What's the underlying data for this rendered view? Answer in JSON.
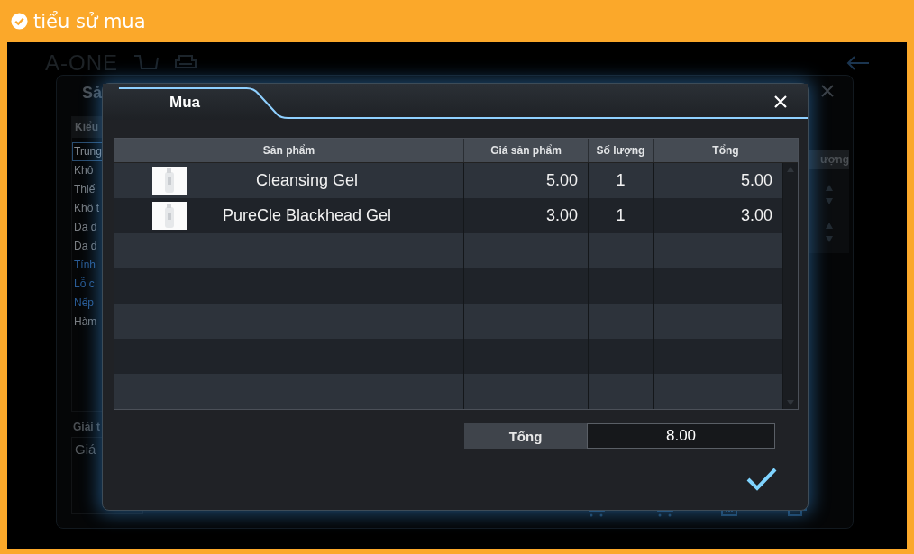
{
  "header": {
    "title": "tiểu sử mua"
  },
  "background_screen": {
    "logo": "A-ONE",
    "title": "Sả",
    "list_header": "Kiểu",
    "list_items": [
      {
        "label": "Trung",
        "selected": true,
        "kind": "plain"
      },
      {
        "label": "Khô",
        "selected": false,
        "kind": "plain"
      },
      {
        "label": "Thiế",
        "selected": false,
        "kind": "plain"
      },
      {
        "label": "Khô t",
        "selected": false,
        "kind": "plain"
      },
      {
        "label": "Da d",
        "selected": false,
        "kind": "plain"
      },
      {
        "label": "Da d",
        "selected": false,
        "kind": "plain"
      },
      {
        "label": "Tính",
        "selected": false,
        "kind": "link"
      },
      {
        "label": "Lỗ c",
        "selected": false,
        "kind": "link"
      },
      {
        "label": "Nếp",
        "selected": false,
        "kind": "link"
      },
      {
        "label": "Hàm",
        "selected": false,
        "kind": "plain"
      }
    ],
    "description_label": "Giải t",
    "description_value": "Giá",
    "column_header": "ượng"
  },
  "dialog": {
    "title": "Mua",
    "columns": [
      "Sản phẩm",
      "Giá sản phẩm",
      "Số lượng",
      "Tổng"
    ],
    "rows": [
      {
        "product": "Cleansing Gel",
        "price": "5.00",
        "quantity": "1",
        "total": "5.00"
      },
      {
        "product": "PureCle Blackhead Gel",
        "price": "3.00",
        "quantity": "1",
        "total": "3.00"
      }
    ],
    "total": {
      "label": "Tổng",
      "value": "8.00"
    }
  }
}
